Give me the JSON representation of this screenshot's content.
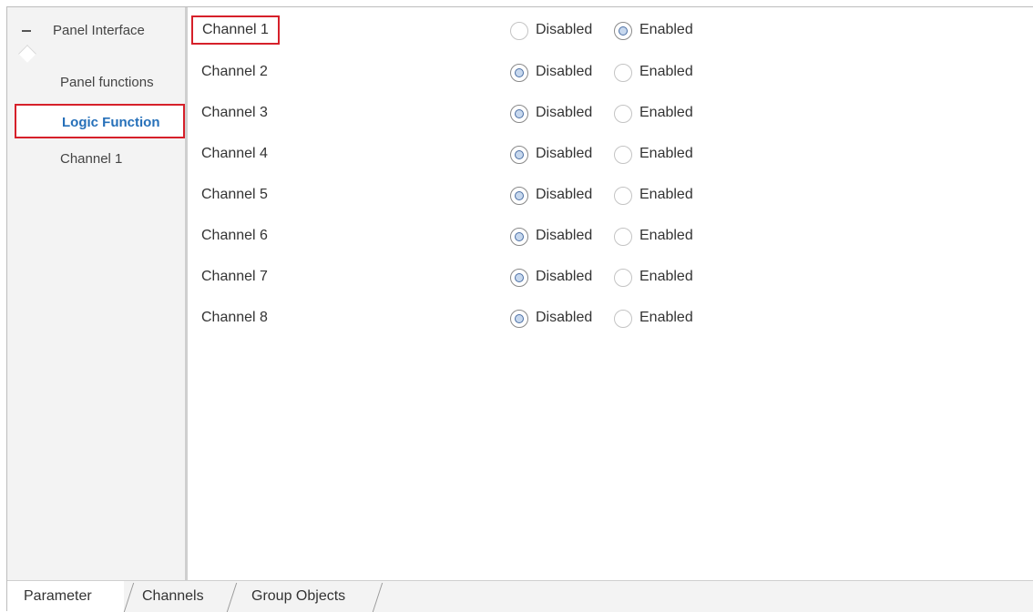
{
  "sidebar": {
    "header_label": "Panel Interface",
    "items": [
      {
        "label": "Panel functions"
      },
      {
        "label": "Logic Function"
      },
      {
        "label": "Channel 1"
      }
    ]
  },
  "options": {
    "disabled": "Disabled",
    "enabled": "Enabled"
  },
  "channels": [
    {
      "label": "Channel 1",
      "value": "Enabled"
    },
    {
      "label": "Channel 2",
      "value": "Disabled"
    },
    {
      "label": "Channel 3",
      "value": "Disabled"
    },
    {
      "label": "Channel 4",
      "value": "Disabled"
    },
    {
      "label": "Channel 5",
      "value": "Disabled"
    },
    {
      "label": "Channel 6",
      "value": "Disabled"
    },
    {
      "label": "Channel 7",
      "value": "Disabled"
    },
    {
      "label": "Channel 8",
      "value": "Disabled"
    }
  ],
  "tabs": [
    {
      "label": "Parameter"
    },
    {
      "label": "Channels"
    },
    {
      "label": "Group Objects"
    }
  ],
  "colors": {
    "active_text": "#2670b9",
    "highlight": "#d6202a"
  }
}
